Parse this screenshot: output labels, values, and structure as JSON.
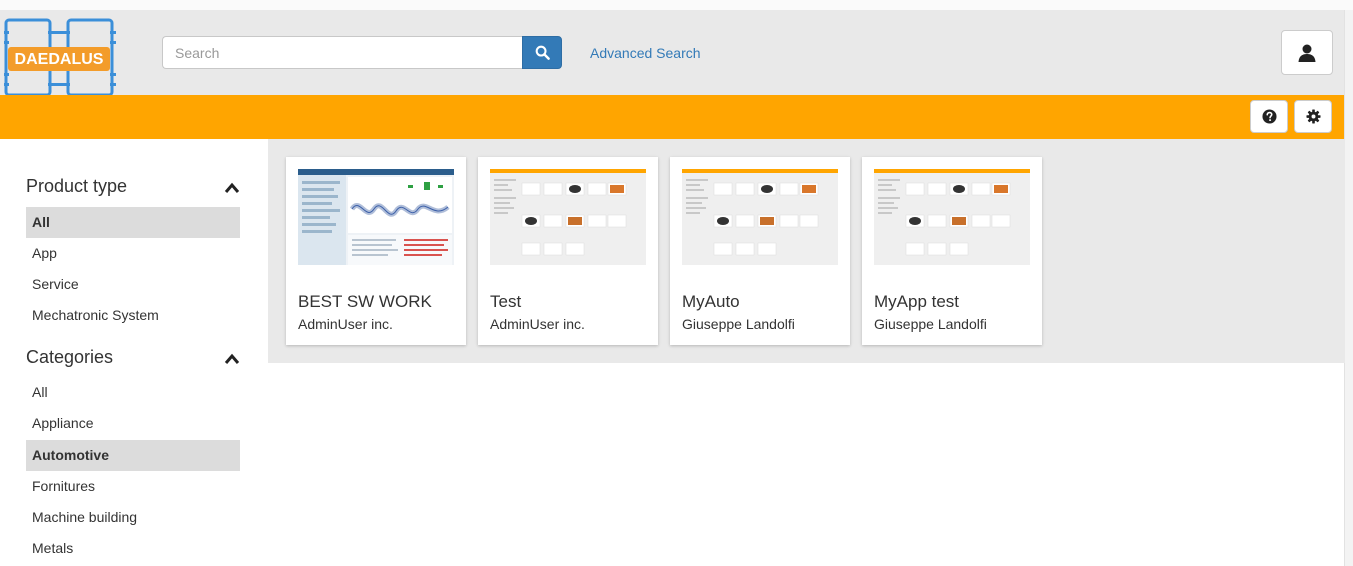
{
  "app": {
    "logo_text": "DAEDALUS"
  },
  "header": {
    "search": {
      "placeholder": "Search",
      "value": ""
    },
    "advanced_search_label": "Advanced Search",
    "user_icon": "user-icon"
  },
  "toolbar": {
    "help_icon": "question-circle-icon",
    "settings_icon": "gear-icon"
  },
  "colors": {
    "accent": "#ffa500",
    "primary": "#337ab7",
    "header_bg": "#e9e9e9"
  },
  "sidebar": {
    "product_type": {
      "title": "Product type",
      "items": [
        {
          "label": "All",
          "active": true
        },
        {
          "label": "App",
          "active": false
        },
        {
          "label": "Service",
          "active": false
        },
        {
          "label": "Mechatronic System",
          "active": false
        }
      ]
    },
    "categories": {
      "title": "Categories",
      "items": [
        {
          "label": "All",
          "active": false
        },
        {
          "label": "Appliance",
          "active": false
        },
        {
          "label": "Automotive",
          "active": true
        },
        {
          "label": "Fornitures",
          "active": false
        },
        {
          "label": "Machine building",
          "active": false
        },
        {
          "label": "Metals",
          "active": false
        }
      ]
    }
  },
  "products": [
    {
      "title": "BEST SW WORK",
      "owner": "AdminUser inc.",
      "thumbnail": "chart-screenshot"
    },
    {
      "title": "Test",
      "owner": "AdminUser inc.",
      "thumbnail": "store-screenshot"
    },
    {
      "title": "MyAuto",
      "owner": "Giuseppe Landolfi",
      "thumbnail": "store-screenshot"
    },
    {
      "title": "MyApp test",
      "owner": "Giuseppe Landolfi",
      "thumbnail": "store-screenshot"
    }
  ]
}
